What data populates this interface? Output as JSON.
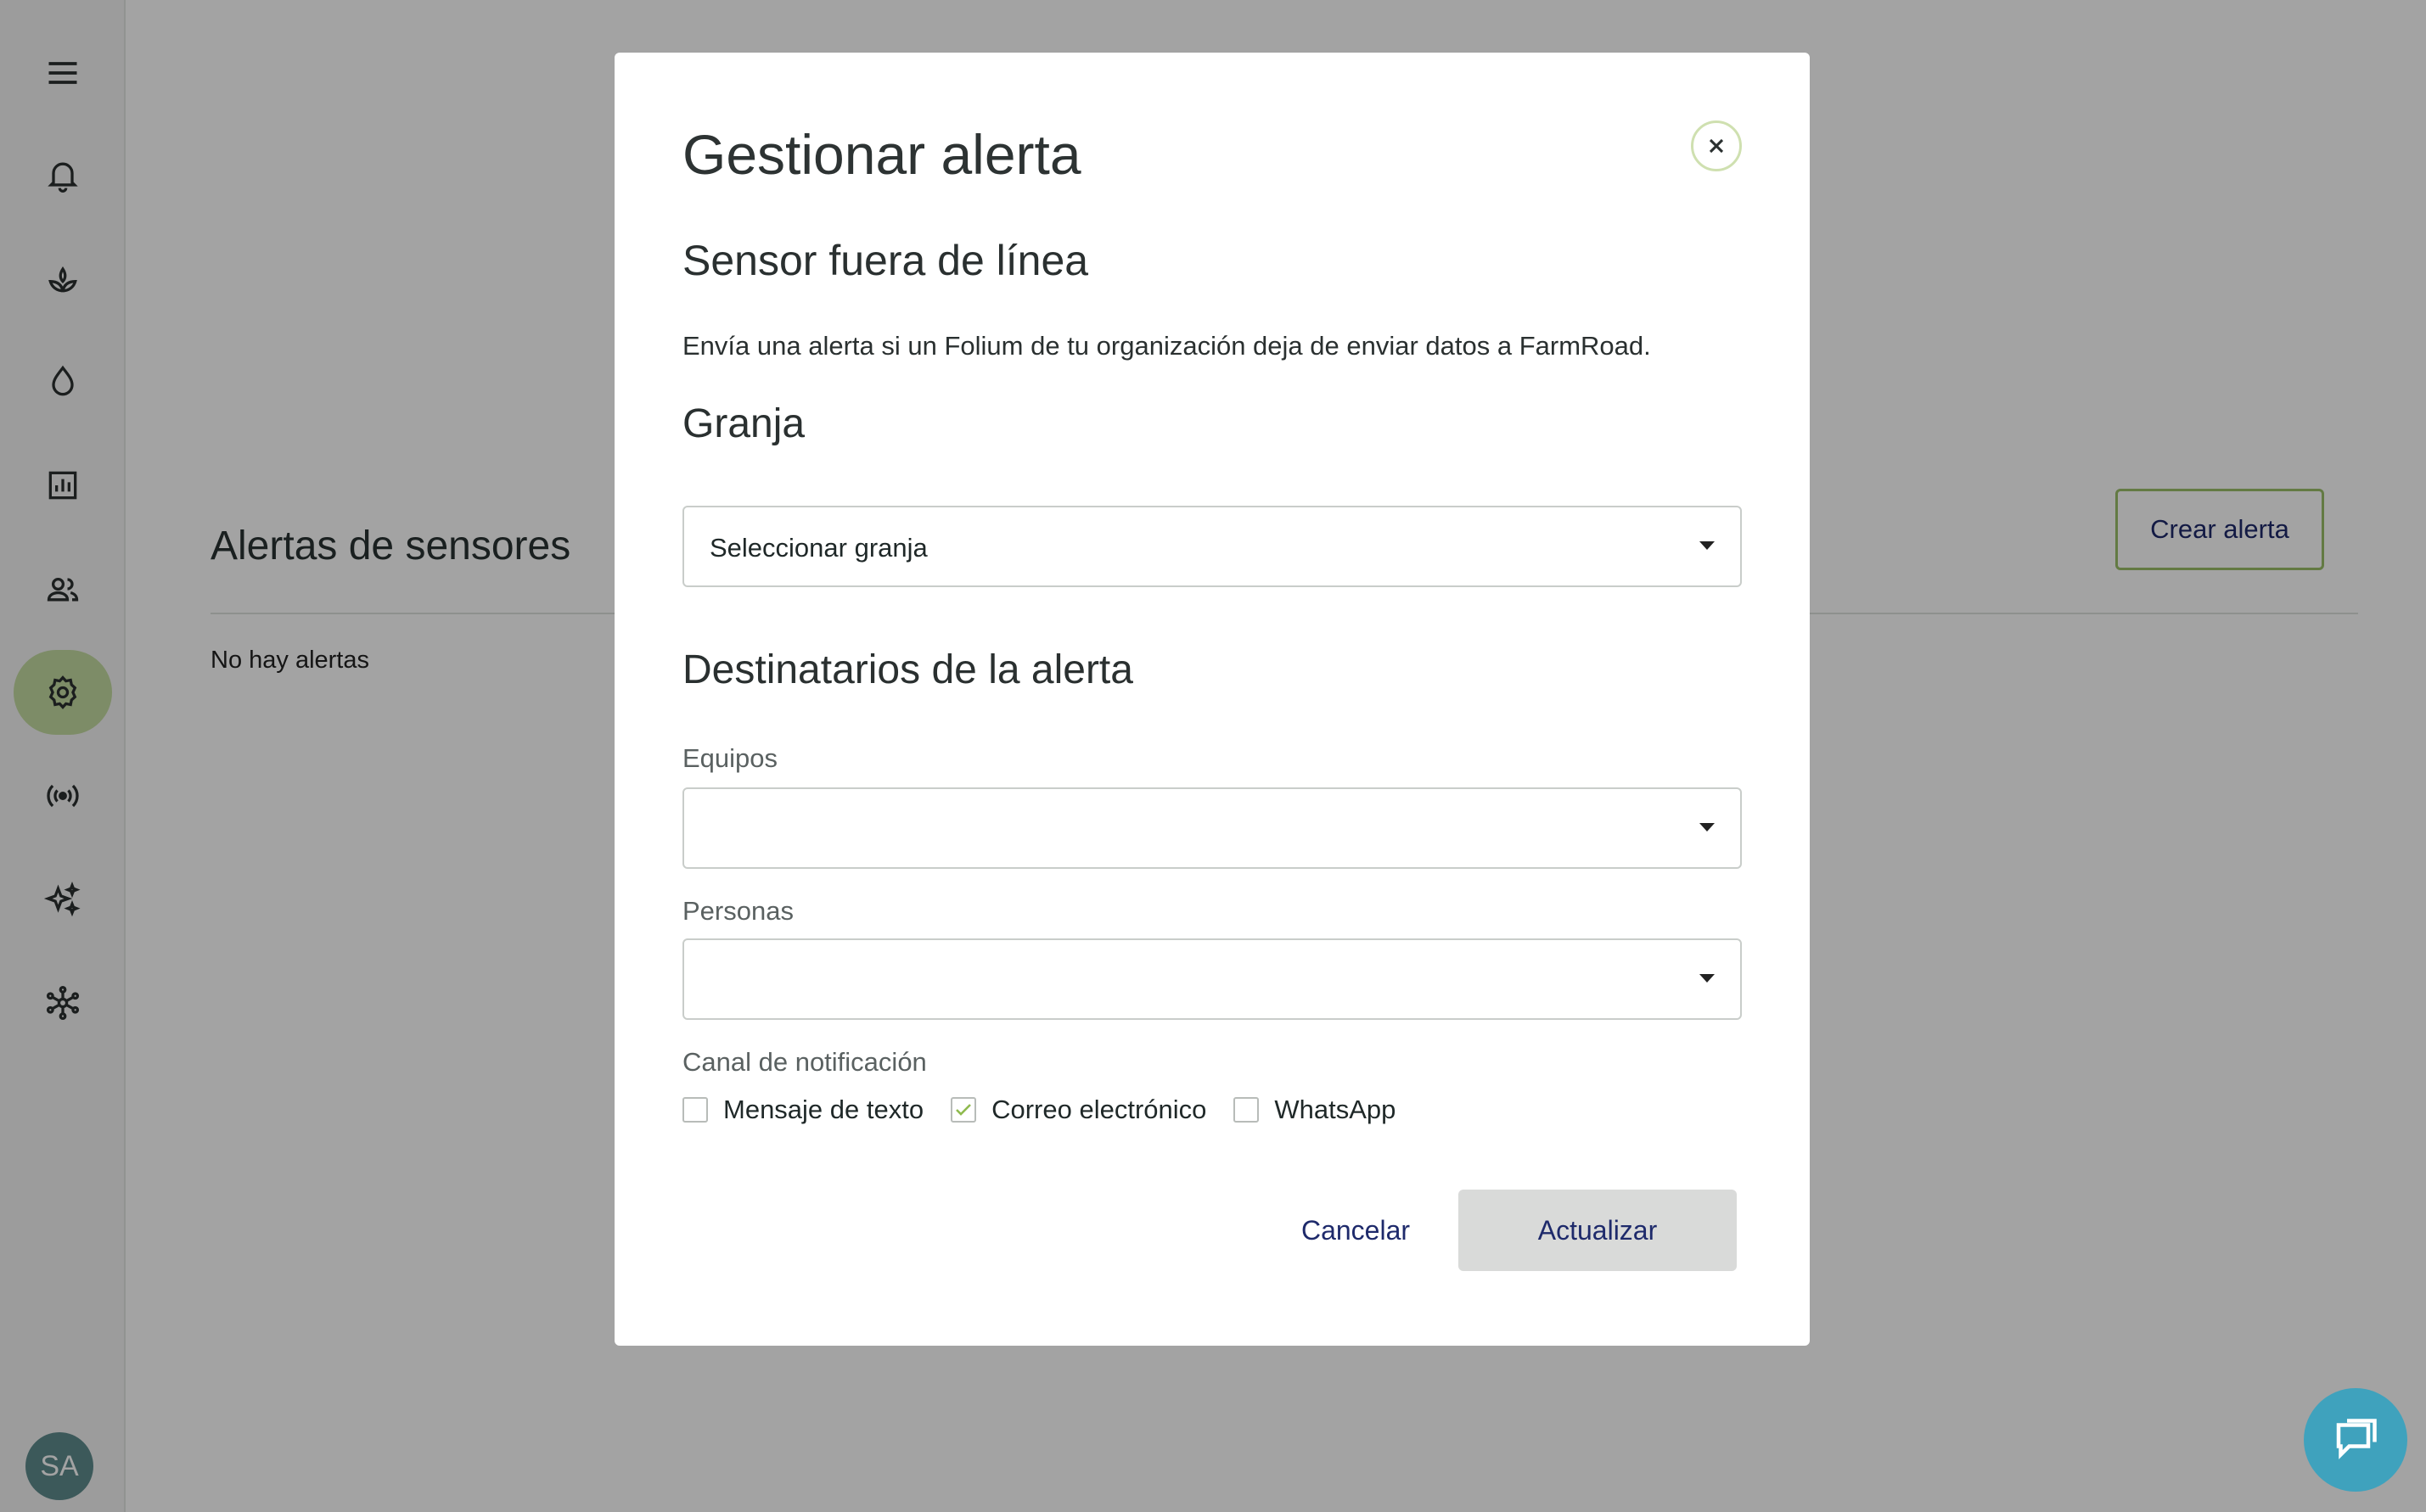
{
  "sidebar": {
    "items": [
      {
        "icon": "menu-icon"
      },
      {
        "icon": "bell-icon"
      },
      {
        "icon": "sprout-icon"
      },
      {
        "icon": "water-drop-icon"
      },
      {
        "icon": "bar-chart-icon"
      },
      {
        "icon": "users-icon"
      },
      {
        "icon": "gear-icon",
        "active": true
      },
      {
        "icon": "broadcast-icon"
      },
      {
        "icon": "sparkles-icon"
      },
      {
        "icon": "network-icon"
      }
    ],
    "avatar_initials": "SA",
    "active_color": "#c4dba1"
  },
  "page": {
    "title": "Alertas de sensores",
    "create_button": "Crear alerta",
    "empty_message": "No hay alertas"
  },
  "modal": {
    "title": "Gestionar alerta",
    "close_icon": "close-icon",
    "alert_type": "Sensor fuera de línea",
    "description": "Envía una alerta si un Folium de tu organización deja de enviar datos a FarmRoad.",
    "farm_section": "Granja",
    "farm_select": {
      "value": "Seleccionar granja"
    },
    "recipients_section": "Destinatarios de la alerta",
    "teams": {
      "label": "Equipos",
      "value": ""
    },
    "people": {
      "label": "Personas",
      "value": ""
    },
    "channel": {
      "label": "Canal de notificación",
      "options": [
        {
          "label": "Mensaje de texto",
          "checked": false
        },
        {
          "label": "Correo electrónico",
          "checked": true
        },
        {
          "label": "WhatsApp",
          "checked": false
        }
      ]
    },
    "cancel_button": "Cancelar",
    "update_button": "Actualizar"
  },
  "chat_widget": {
    "icon": "chat-icon",
    "color": "#3fa2bd"
  }
}
